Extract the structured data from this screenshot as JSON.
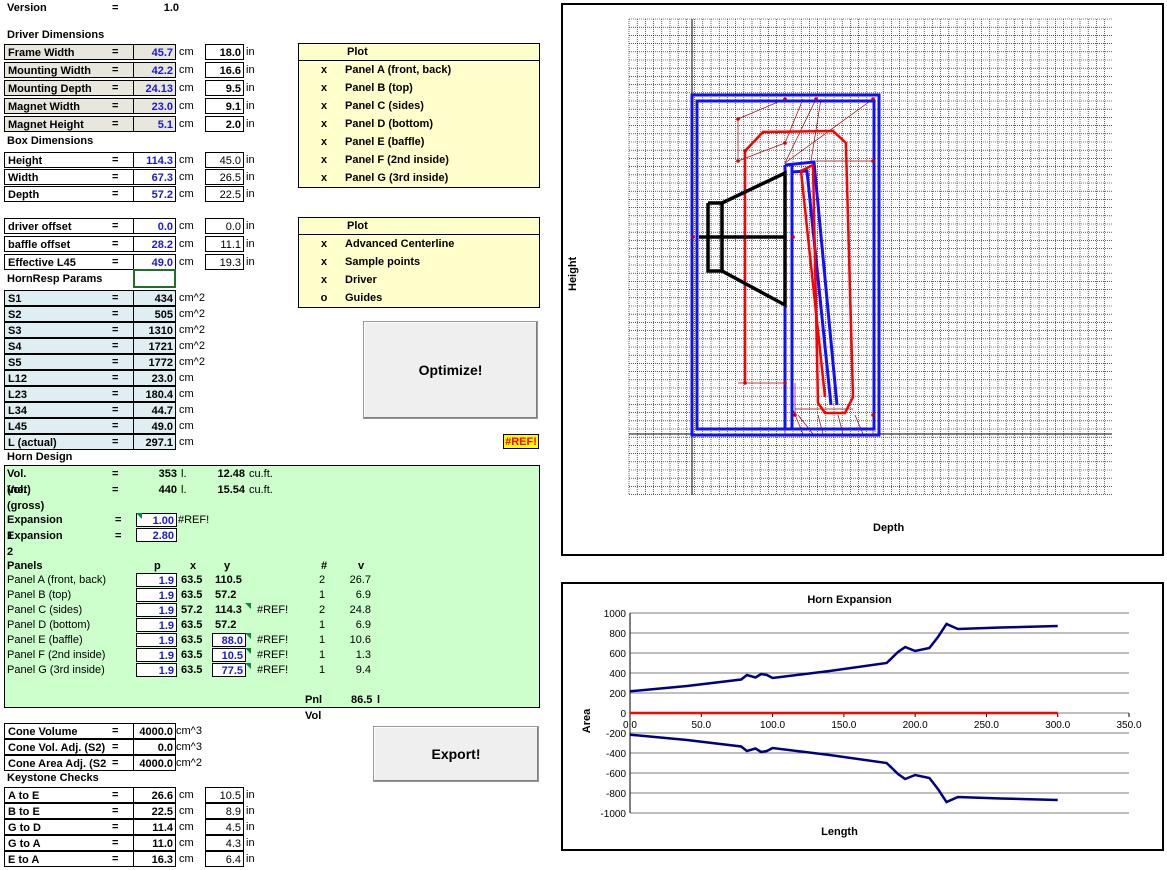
{
  "version": {
    "label": "Version",
    "eq": "=",
    "value": "1.0"
  },
  "driver": {
    "title": "Driver Dimensions",
    "rows": [
      {
        "label": "Frame Width",
        "value": "45.7",
        "unit": "cm",
        "inch": "18.0",
        "inunit": "in"
      },
      {
        "label": "Mounting Width",
        "value": "42.2",
        "unit": "cm",
        "inch": "16.6",
        "inunit": "in"
      },
      {
        "label": "Mounting Depth",
        "value": "24.13",
        "unit": "cm",
        "inch": "9.5",
        "inunit": "in"
      },
      {
        "label": "Magnet Width",
        "value": "23.0",
        "unit": "cm",
        "inch": "9.1",
        "inunit": "in"
      },
      {
        "label": "Magnet Height",
        "value": "5.1",
        "unit": "cm",
        "inch": "2.0",
        "inunit": "in"
      }
    ]
  },
  "box": {
    "title": "Box Dimensions",
    "rows": [
      {
        "label": "Height",
        "value": "114.3",
        "unit": "cm",
        "inch": "45.0",
        "inunit": "in"
      },
      {
        "label": "Width",
        "value": "67.3",
        "unit": "cm",
        "inch": "26.5",
        "inunit": "in"
      },
      {
        "label": "Depth",
        "value": "57.2",
        "unit": "cm",
        "inch": "22.5",
        "inunit": "in"
      }
    ]
  },
  "offsets": {
    "rows": [
      {
        "label": "driver offset",
        "value": "0.0",
        "unit": "cm",
        "inch": "0.0",
        "inunit": "in"
      },
      {
        "label": "baffle offset",
        "value": "28.2",
        "unit": "cm",
        "inch": "11.1",
        "inunit": "in"
      },
      {
        "label": "Effective L45",
        "value": "49.0",
        "unit": "cm",
        "inch": "19.3",
        "inunit": "in"
      }
    ]
  },
  "plot1": {
    "title": "Plot",
    "items": [
      {
        "mark": "x",
        "name": "Panel A (front, back)"
      },
      {
        "mark": "x",
        "name": "Panel B (top)"
      },
      {
        "mark": "x",
        "name": "Panel C (sides)"
      },
      {
        "mark": "x",
        "name": "Panel D (bottom)"
      },
      {
        "mark": "x",
        "name": "Panel E (baffle)"
      },
      {
        "mark": "x",
        "name": "Panel F (2nd inside)"
      },
      {
        "mark": "x",
        "name": "Panel G (3rd inside)"
      }
    ]
  },
  "plot2": {
    "title": "Plot",
    "items": [
      {
        "mark": "x",
        "name": "Advanced Centerline"
      },
      {
        "mark": "x",
        "name": "Sample points"
      },
      {
        "mark": "x",
        "name": "Driver"
      },
      {
        "mark": "o",
        "name": "Guides"
      }
    ]
  },
  "hornresp": {
    "title": "HornResp Params",
    "rows": [
      {
        "label": "S1",
        "value": "434",
        "unit": "cm^2"
      },
      {
        "label": "S2",
        "value": "505",
        "unit": "cm^2"
      },
      {
        "label": "S3",
        "value": "1310",
        "unit": "cm^2"
      },
      {
        "label": "S4",
        "value": "1721",
        "unit": "cm^2"
      },
      {
        "label": "S5",
        "value": "1772",
        "unit": "cm^2"
      },
      {
        "label": "L12",
        "value": "23.0",
        "unit": "cm"
      },
      {
        "label": "L23",
        "value": "180.4",
        "unit": "cm"
      },
      {
        "label": "L34",
        "value": "44.7",
        "unit": "cm"
      },
      {
        "label": "L45",
        "value": "49.0",
        "unit": "cm"
      },
      {
        "label": "L (actual)",
        "value": "297.1",
        "unit": "cm"
      }
    ]
  },
  "buttons": {
    "optimize": "Optimize!",
    "export": "Export!"
  },
  "error_badge": "#REF!",
  "horn": {
    "title": "Horn Design",
    "vol_net": {
      "label": "Vol. (net)",
      "eq": "=",
      "value": "353",
      "unit": "l.",
      "cuft": "12.48",
      "cuunit": "cu.ft."
    },
    "vol_gross": {
      "label": "Vol. (gross)",
      "eq": "=",
      "value": "440",
      "unit": "l.",
      "cuft": "15.54",
      "cuunit": "cu.ft."
    },
    "exp1": {
      "label": "Expansion 1",
      "eq": "=",
      "value": "1.00",
      "note": "#REF!"
    },
    "exp2": {
      "label": "Expansion 2",
      "eq": "=",
      "value": "2.80"
    },
    "panels_header": {
      "label": "Panels",
      "p": "p",
      "x": "x",
      "y": "y",
      "n": "#",
      "v": "v"
    },
    "panels": [
      {
        "name": "Panel A (front, back)",
        "p": "1.9",
        "x": "63.5",
        "y": "110.5",
        "err": "",
        "n": "2",
        "v": "26.7"
      },
      {
        "name": "Panel B (top)",
        "p": "1.9",
        "x": "63.5",
        "y": "57.2",
        "err": "",
        "n": "1",
        "v": "6.9"
      },
      {
        "name": "Panel C (sides)",
        "p": "1.9",
        "x": "57.2",
        "y": "114.3",
        "err": "#REF!",
        "n": "2",
        "v": "24.8"
      },
      {
        "name": "Panel D (bottom)",
        "p": "1.9",
        "x": "63.5",
        "y": "57.2",
        "err": "",
        "n": "1",
        "v": "6.9"
      },
      {
        "name": "Panel E (baffle)",
        "p": "1.9",
        "x": "63.5",
        "y": "88.0",
        "err": "#REF!",
        "n": "1",
        "v": "10.6"
      },
      {
        "name": "Panel F (2nd inside)",
        "p": "1.9",
        "x": "63.5",
        "y": "10.5",
        "err": "#REF!",
        "n": "1",
        "v": "1.3"
      },
      {
        "name": "Panel G (3rd inside)",
        "p": "1.9",
        "x": "63.5",
        "y": "77.5",
        "err": "#REF!",
        "n": "1",
        "v": "9.4"
      }
    ],
    "pnl_vol": {
      "label": "Pnl Vol",
      "value": "86.5",
      "unit": "l"
    }
  },
  "cone": {
    "rows": [
      {
        "label": "Cone Volume",
        "value": "4000.0",
        "unit": "cm^3"
      },
      {
        "label": "Cone Vol. Adj. (S2)",
        "value": "0.0",
        "unit": "cm^3"
      },
      {
        "label": "Cone Area Adj. (S2",
        "value": "4000.0",
        "unit": "cm^2"
      }
    ]
  },
  "keystone": {
    "title": "Keystone Checks",
    "rows": [
      {
        "label": "A to E",
        "value": "26.6",
        "unit": "cm",
        "inch": "10.5",
        "inunit": "in"
      },
      {
        "label": "B to E",
        "value": "22.5",
        "unit": "cm",
        "inch": "8.9",
        "inunit": "in"
      },
      {
        "label": "G to D",
        "value": "11.4",
        "unit": "cm",
        "inch": "4.5",
        "inunit": "in"
      },
      {
        "label": "G to A",
        "value": "11.0",
        "unit": "cm",
        "inch": "4.3",
        "inunit": "in"
      },
      {
        "label": "E to A",
        "value": "16.3",
        "cm": "cm",
        "unit": "cm",
        "inch": "6.4",
        "inunit": "in"
      }
    ]
  },
  "diagram": {
    "xlabel": "Depth",
    "ylabel": "Height"
  },
  "chart_data": {
    "type": "line",
    "title": "Horn Expansion",
    "xlabel": "Length",
    "ylabel": "Area",
    "xlim": [
      0,
      350
    ],
    "ylim": [
      -1000,
      1000
    ],
    "xticks": [
      "0.0",
      "50.0",
      "100.0",
      "150.0",
      "200.0",
      "250.0",
      "300.0",
      "350.0"
    ],
    "yticks": [
      "1000",
      "800",
      "600",
      "400",
      "200",
      "0",
      "-200",
      "-400",
      "-600",
      "-800",
      "-1000"
    ],
    "colors": {
      "upper": "#000080",
      "lower": "#000080",
      "zero": "#ff0000"
    },
    "series": [
      {
        "values": [
          [
            0,
            217
          ],
          [
            40,
            270
          ],
          [
            78,
            335
          ],
          [
            82,
            380
          ],
          [
            88,
            355
          ],
          [
            92,
            390
          ],
          [
            96,
            380
          ],
          [
            100,
            350
          ],
          [
            140,
            420
          ],
          [
            180,
            500
          ],
          [
            188,
            610
          ],
          [
            193,
            660
          ],
          [
            200,
            620
          ],
          [
            210,
            650
          ],
          [
            216,
            760
          ],
          [
            222,
            890
          ],
          [
            230,
            840
          ],
          [
            260,
            855
          ],
          [
            300,
            870
          ]
        ]
      },
      {
        "values": [
          [
            0,
            -217
          ],
          [
            40,
            -270
          ],
          [
            78,
            -335
          ],
          [
            82,
            -380
          ],
          [
            88,
            -355
          ],
          [
            92,
            -390
          ],
          [
            96,
            -380
          ],
          [
            100,
            -350
          ],
          [
            140,
            -420
          ],
          [
            180,
            -500
          ],
          [
            188,
            -610
          ],
          [
            193,
            -660
          ],
          [
            200,
            -620
          ],
          [
            210,
            -650
          ],
          [
            216,
            -760
          ],
          [
            222,
            -890
          ],
          [
            230,
            -840
          ],
          [
            260,
            -855
          ],
          [
            300,
            -870
          ]
        ]
      },
      {
        "values": [
          [
            0,
            0
          ],
          [
            300,
            0
          ]
        ]
      }
    ]
  }
}
